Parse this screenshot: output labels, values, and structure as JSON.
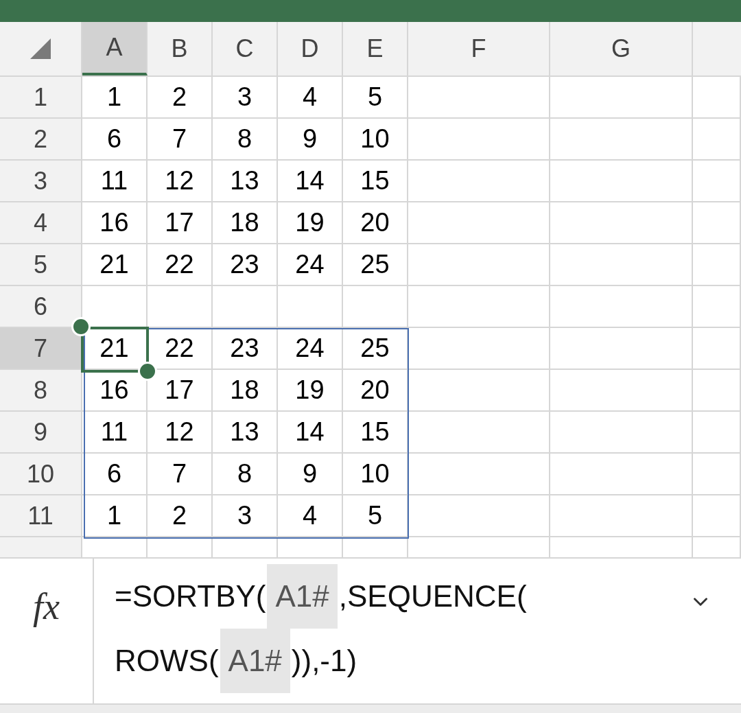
{
  "columns": [
    {
      "label": "A",
      "selected": true
    },
    {
      "label": "B",
      "selected": false
    },
    {
      "label": "C",
      "selected": false
    },
    {
      "label": "D",
      "selected": false
    },
    {
      "label": "E",
      "selected": false
    },
    {
      "label": "F",
      "selected": false
    },
    {
      "label": "G",
      "selected": false
    }
  ],
  "rows": [
    {
      "label": "1",
      "selected": false,
      "spill": false,
      "cells": [
        "1",
        "2",
        "3",
        "4",
        "5"
      ]
    },
    {
      "label": "2",
      "selected": false,
      "spill": false,
      "cells": [
        "6",
        "7",
        "8",
        "9",
        "10"
      ]
    },
    {
      "label": "3",
      "selected": false,
      "spill": false,
      "cells": [
        "11",
        "12",
        "13",
        "14",
        "15"
      ]
    },
    {
      "label": "4",
      "selected": false,
      "spill": false,
      "cells": [
        "16",
        "17",
        "18",
        "19",
        "20"
      ]
    },
    {
      "label": "5",
      "selected": false,
      "spill": false,
      "cells": [
        "21",
        "22",
        "23",
        "24",
        "25"
      ]
    },
    {
      "label": "6",
      "selected": false,
      "spill": false,
      "cells": []
    },
    {
      "label": "7",
      "selected": true,
      "spill": true,
      "cells": [
        "21",
        "22",
        "23",
        "24",
        "25"
      ]
    },
    {
      "label": "8",
      "selected": false,
      "spill": true,
      "cells": [
        "16",
        "17",
        "18",
        "19",
        "20"
      ]
    },
    {
      "label": "9",
      "selected": false,
      "spill": true,
      "cells": [
        "11",
        "12",
        "13",
        "14",
        "15"
      ]
    },
    {
      "label": "10",
      "selected": false,
      "spill": true,
      "cells": [
        "6",
        "7",
        "8",
        "9",
        "10"
      ]
    },
    {
      "label": "11",
      "selected": false,
      "spill": true,
      "cells": [
        "1",
        "2",
        "3",
        "4",
        "5"
      ]
    }
  ],
  "formula_bar": {
    "function_label": "fx",
    "lines": [
      [
        {
          "kind": "text",
          "text": "=SORTBY("
        },
        {
          "kind": "ref",
          "text": "A1#"
        },
        {
          "kind": "text",
          "text": ",SEQUENCE("
        }
      ],
      [
        {
          "kind": "text",
          "text": "ROWS("
        },
        {
          "kind": "ref",
          "text": "A1#"
        },
        {
          "kind": "text",
          "text": ")),-1)"
        }
      ]
    ]
  }
}
